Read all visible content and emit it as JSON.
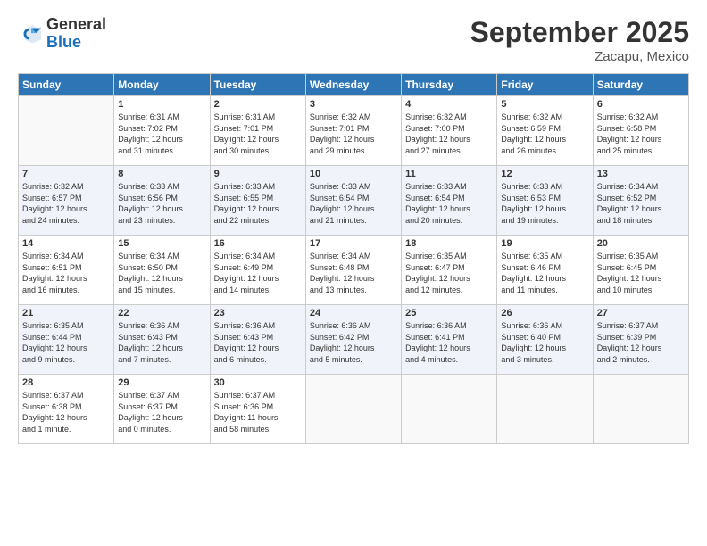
{
  "logo": {
    "line1": "General",
    "line2": "Blue"
  },
  "title": "September 2025",
  "location": "Zacapu, Mexico",
  "days_of_week": [
    "Sunday",
    "Monday",
    "Tuesday",
    "Wednesday",
    "Thursday",
    "Friday",
    "Saturday"
  ],
  "weeks": [
    [
      {
        "num": "",
        "info": ""
      },
      {
        "num": "1",
        "info": "Sunrise: 6:31 AM\nSunset: 7:02 PM\nDaylight: 12 hours\nand 31 minutes."
      },
      {
        "num": "2",
        "info": "Sunrise: 6:31 AM\nSunset: 7:01 PM\nDaylight: 12 hours\nand 30 minutes."
      },
      {
        "num": "3",
        "info": "Sunrise: 6:32 AM\nSunset: 7:01 PM\nDaylight: 12 hours\nand 29 minutes."
      },
      {
        "num": "4",
        "info": "Sunrise: 6:32 AM\nSunset: 7:00 PM\nDaylight: 12 hours\nand 27 minutes."
      },
      {
        "num": "5",
        "info": "Sunrise: 6:32 AM\nSunset: 6:59 PM\nDaylight: 12 hours\nand 26 minutes."
      },
      {
        "num": "6",
        "info": "Sunrise: 6:32 AM\nSunset: 6:58 PM\nDaylight: 12 hours\nand 25 minutes."
      }
    ],
    [
      {
        "num": "7",
        "info": "Sunrise: 6:32 AM\nSunset: 6:57 PM\nDaylight: 12 hours\nand 24 minutes."
      },
      {
        "num": "8",
        "info": "Sunrise: 6:33 AM\nSunset: 6:56 PM\nDaylight: 12 hours\nand 23 minutes."
      },
      {
        "num": "9",
        "info": "Sunrise: 6:33 AM\nSunset: 6:55 PM\nDaylight: 12 hours\nand 22 minutes."
      },
      {
        "num": "10",
        "info": "Sunrise: 6:33 AM\nSunset: 6:54 PM\nDaylight: 12 hours\nand 21 minutes."
      },
      {
        "num": "11",
        "info": "Sunrise: 6:33 AM\nSunset: 6:54 PM\nDaylight: 12 hours\nand 20 minutes."
      },
      {
        "num": "12",
        "info": "Sunrise: 6:33 AM\nSunset: 6:53 PM\nDaylight: 12 hours\nand 19 minutes."
      },
      {
        "num": "13",
        "info": "Sunrise: 6:34 AM\nSunset: 6:52 PM\nDaylight: 12 hours\nand 18 minutes."
      }
    ],
    [
      {
        "num": "14",
        "info": "Sunrise: 6:34 AM\nSunset: 6:51 PM\nDaylight: 12 hours\nand 16 minutes."
      },
      {
        "num": "15",
        "info": "Sunrise: 6:34 AM\nSunset: 6:50 PM\nDaylight: 12 hours\nand 15 minutes."
      },
      {
        "num": "16",
        "info": "Sunrise: 6:34 AM\nSunset: 6:49 PM\nDaylight: 12 hours\nand 14 minutes."
      },
      {
        "num": "17",
        "info": "Sunrise: 6:34 AM\nSunset: 6:48 PM\nDaylight: 12 hours\nand 13 minutes."
      },
      {
        "num": "18",
        "info": "Sunrise: 6:35 AM\nSunset: 6:47 PM\nDaylight: 12 hours\nand 12 minutes."
      },
      {
        "num": "19",
        "info": "Sunrise: 6:35 AM\nSunset: 6:46 PM\nDaylight: 12 hours\nand 11 minutes."
      },
      {
        "num": "20",
        "info": "Sunrise: 6:35 AM\nSunset: 6:45 PM\nDaylight: 12 hours\nand 10 minutes."
      }
    ],
    [
      {
        "num": "21",
        "info": "Sunrise: 6:35 AM\nSunset: 6:44 PM\nDaylight: 12 hours\nand 9 minutes."
      },
      {
        "num": "22",
        "info": "Sunrise: 6:36 AM\nSunset: 6:43 PM\nDaylight: 12 hours\nand 7 minutes."
      },
      {
        "num": "23",
        "info": "Sunrise: 6:36 AM\nSunset: 6:43 PM\nDaylight: 12 hours\nand 6 minutes."
      },
      {
        "num": "24",
        "info": "Sunrise: 6:36 AM\nSunset: 6:42 PM\nDaylight: 12 hours\nand 5 minutes."
      },
      {
        "num": "25",
        "info": "Sunrise: 6:36 AM\nSunset: 6:41 PM\nDaylight: 12 hours\nand 4 minutes."
      },
      {
        "num": "26",
        "info": "Sunrise: 6:36 AM\nSunset: 6:40 PM\nDaylight: 12 hours\nand 3 minutes."
      },
      {
        "num": "27",
        "info": "Sunrise: 6:37 AM\nSunset: 6:39 PM\nDaylight: 12 hours\nand 2 minutes."
      }
    ],
    [
      {
        "num": "28",
        "info": "Sunrise: 6:37 AM\nSunset: 6:38 PM\nDaylight: 12 hours\nand 1 minute."
      },
      {
        "num": "29",
        "info": "Sunrise: 6:37 AM\nSunset: 6:37 PM\nDaylight: 12 hours\nand 0 minutes."
      },
      {
        "num": "30",
        "info": "Sunrise: 6:37 AM\nSunset: 6:36 PM\nDaylight: 11 hours\nand 58 minutes."
      },
      {
        "num": "",
        "info": ""
      },
      {
        "num": "",
        "info": ""
      },
      {
        "num": "",
        "info": ""
      },
      {
        "num": "",
        "info": ""
      }
    ]
  ]
}
